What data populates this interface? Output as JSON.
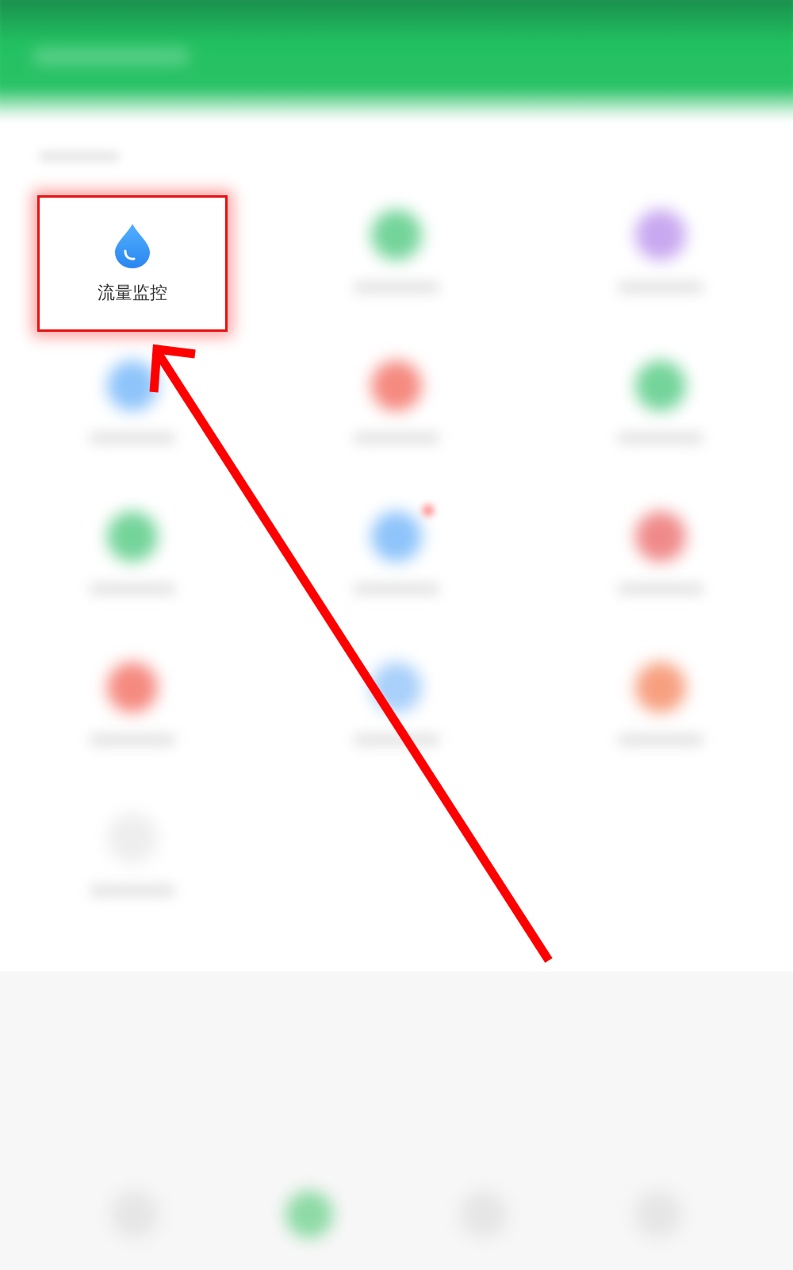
{
  "feature_grid": [
    {
      "kind": "focused",
      "label": "流量监控",
      "highlighted": true
    },
    {
      "kind": "blurred",
      "color": "#74d49a"
    },
    {
      "kind": "blurred",
      "color": "#c8a8f0"
    },
    {
      "kind": "blurred",
      "color": "#8ec4fa"
    },
    {
      "kind": "blurred",
      "color": "#f58a80"
    },
    {
      "kind": "blurred",
      "color": "#74d49a"
    },
    {
      "kind": "blurred",
      "color": "#74d49a"
    },
    {
      "kind": "blurred",
      "color": "#8ec4fa",
      "badge": true
    },
    {
      "kind": "blurred",
      "color": "#f08a8a"
    },
    {
      "kind": "blurred",
      "color": "#f58a80"
    },
    {
      "kind": "blurred",
      "color": "#a8d0fa"
    },
    {
      "kind": "blurred",
      "color": "#f7a080"
    },
    {
      "kind": "blurred",
      "color": "#eeeeee"
    }
  ],
  "bottom_nav": [
    {
      "color": "#e6e6e6"
    },
    {
      "color": "#8edaa6"
    },
    {
      "color": "#e6e6e6"
    },
    {
      "color": "#e6e6e6"
    }
  ],
  "annotation": {
    "arrow": true
  }
}
